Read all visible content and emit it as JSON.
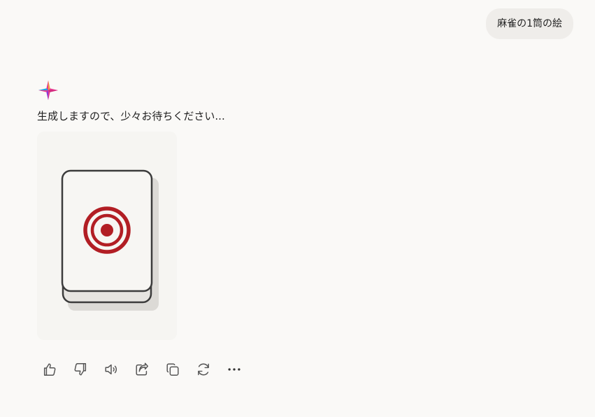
{
  "user_message": {
    "text": "麻雀の1筒の絵"
  },
  "assistant": {
    "avatar_icon": "copilot-logo-icon",
    "message": "生成しますので、少々お待ちください...",
    "image": {
      "subject": "mahjong-1-pin-tile"
    }
  },
  "toolbar": {
    "actions": [
      {
        "name": "like-button",
        "icon": "thumbs-up-icon"
      },
      {
        "name": "dislike-button",
        "icon": "thumbs-down-icon"
      },
      {
        "name": "read-aloud-button",
        "icon": "speaker-icon"
      },
      {
        "name": "share-button",
        "icon": "share-icon"
      },
      {
        "name": "copy-button",
        "icon": "copy-icon"
      },
      {
        "name": "regenerate-button",
        "icon": "refresh-icon"
      },
      {
        "name": "more-options-button",
        "icon": "ellipsis-icon"
      }
    ]
  },
  "colors": {
    "background": "#faf9f7",
    "user_bubble": "#efedea",
    "tile_red": "#b21e24",
    "tile_outline": "#3c3c3c",
    "icon_gray": "#555555"
  }
}
